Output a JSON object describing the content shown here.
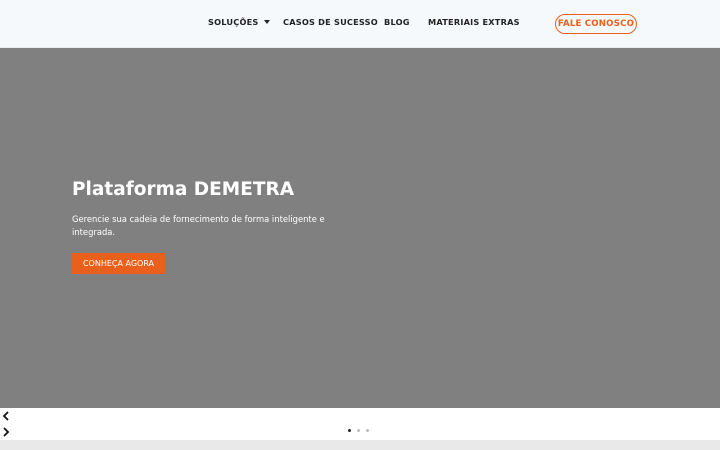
{
  "nav": {
    "items": [
      {
        "label": "SOLUÇÕES",
        "has_dropdown": true
      },
      {
        "label": "CASOS DE SUCESSO",
        "has_dropdown": false
      },
      {
        "label": "BLOG",
        "has_dropdown": false
      },
      {
        "label": "MATERIAIS EXTRAS",
        "has_dropdown": false
      }
    ],
    "contact_label": "FALE CONOSCO"
  },
  "hero": {
    "title": "Plataforma DEMETRA",
    "subtitle": "Gerencie sua cadeia de fornecimento de forma inteligente e integrada.",
    "button_label": "CONHEÇA AGORA"
  },
  "carousel": {
    "prev_icon": "chevron-left-icon",
    "next_icon": "chevron-right-icon",
    "slide_count": 3,
    "active_slide": 1
  },
  "colors": {
    "accent": "#e8601c",
    "hero_background": "#808080",
    "header_background": "#f6f9fc"
  }
}
